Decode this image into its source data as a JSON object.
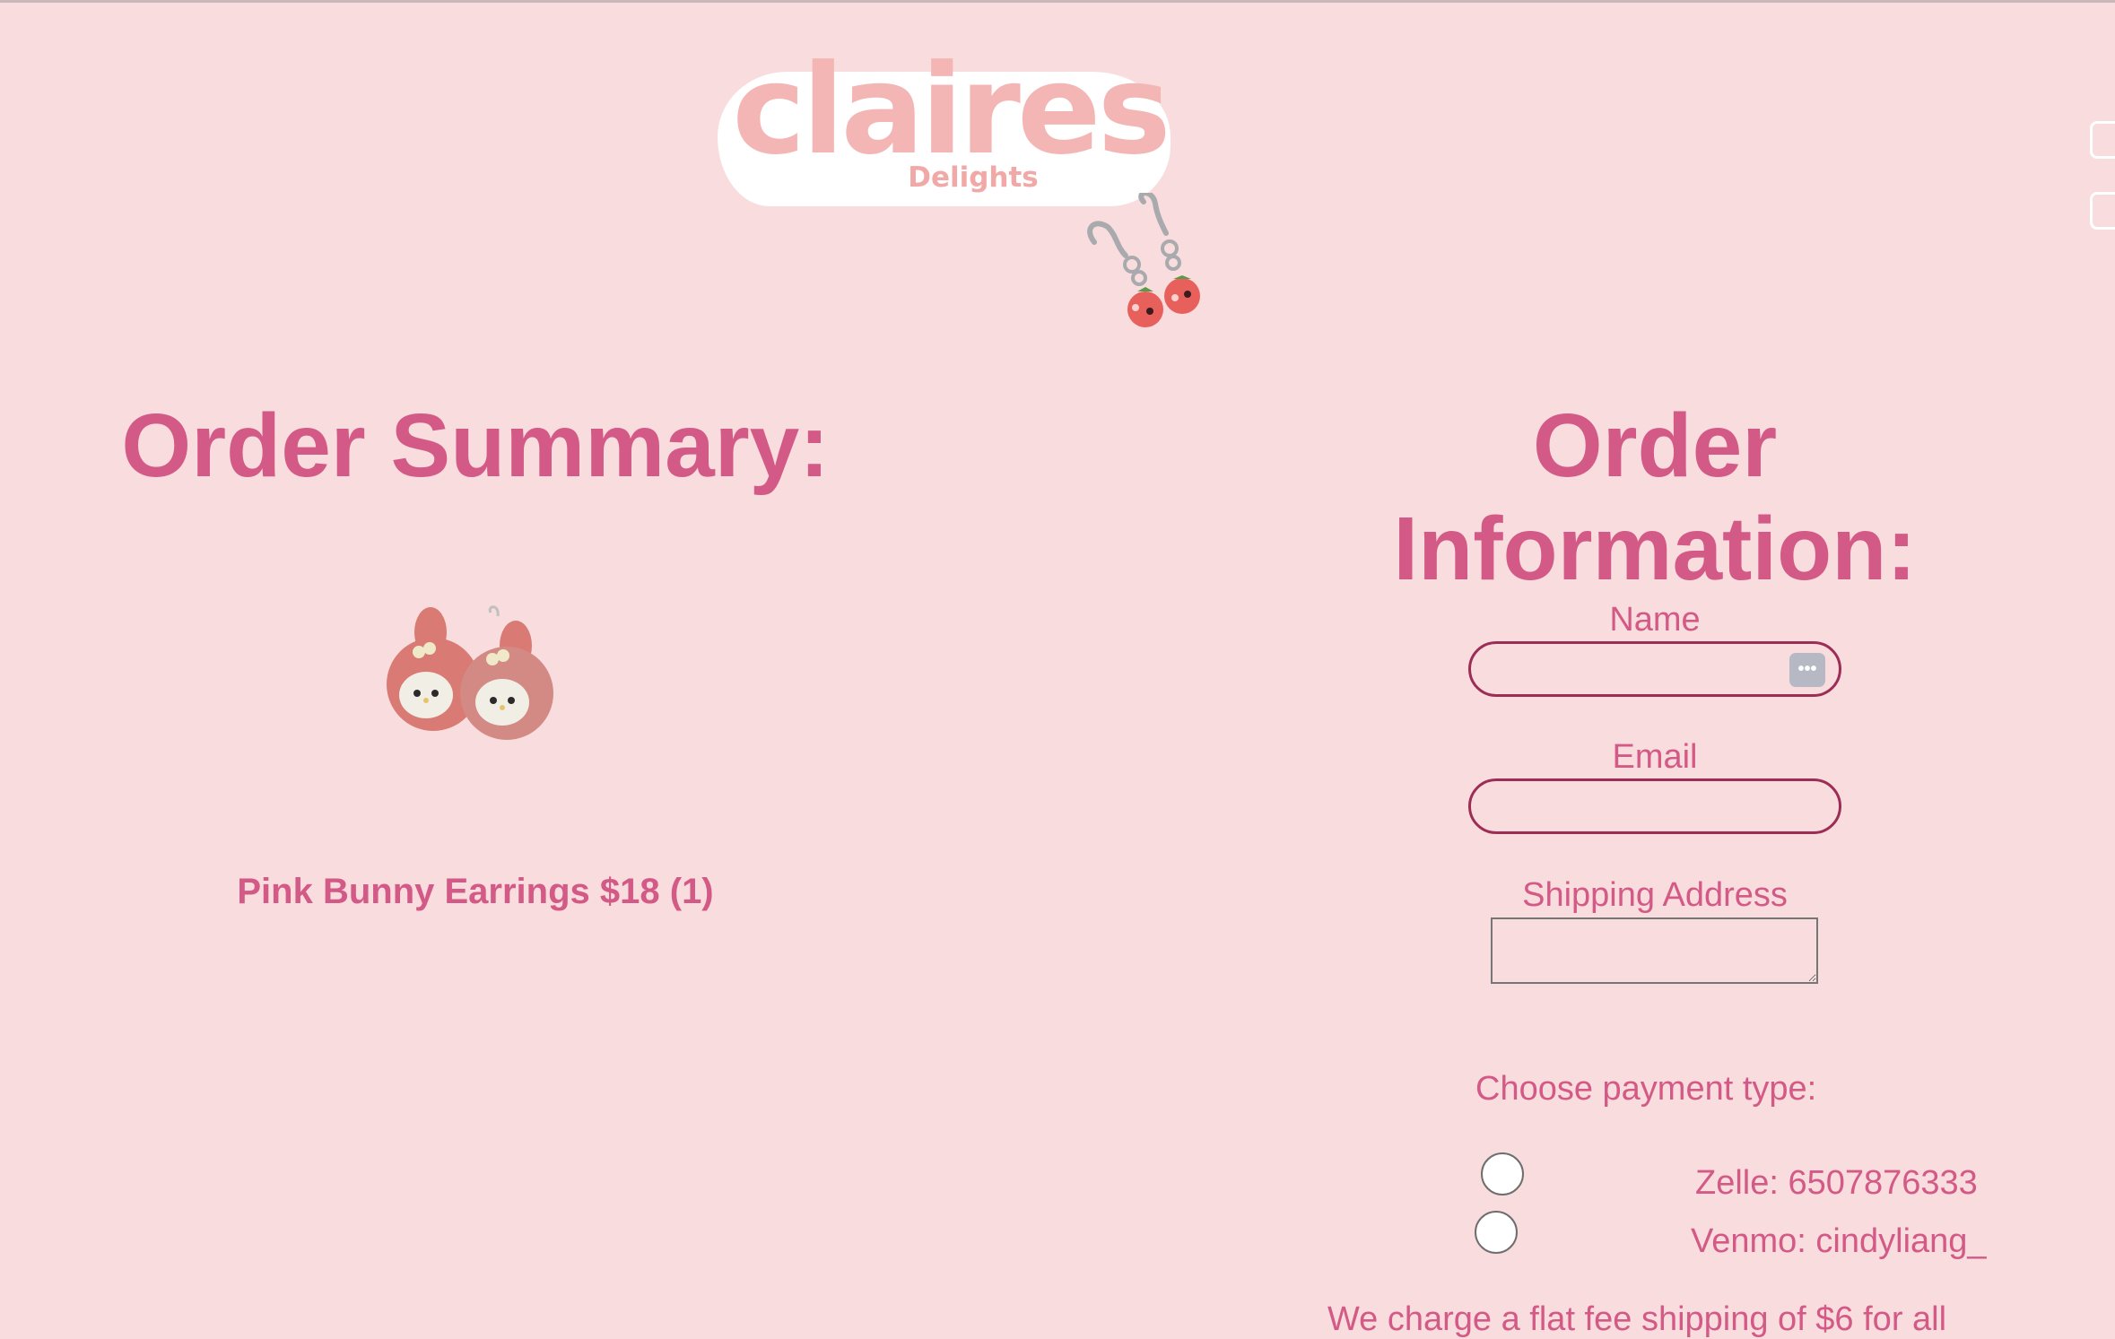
{
  "brand": {
    "logo_main": "claires",
    "logo_sub": "Delights"
  },
  "header_icons": [
    "store-icon",
    "cart-icon"
  ],
  "summary": {
    "title": "Order Summary:",
    "items": [
      {
        "label": "Pink Bunny Earrings $18 (1)"
      }
    ]
  },
  "order_info": {
    "title": "Order Information:",
    "name_label": "Name",
    "email_label": "Email",
    "address_label": "Shipping Address",
    "payment_title": "Choose payment type:",
    "payment_options": [
      {
        "label": "Zelle: 6507876333"
      },
      {
        "label": "Venmo: cindyliang_"
      }
    ],
    "shipping_note": "We charge a flat fee shipping of $6 for all"
  },
  "colors": {
    "background": "#f9dcdd",
    "accent": "#d35a87",
    "input_border": "#9c2d57",
    "logo": "#f3b6b4"
  }
}
